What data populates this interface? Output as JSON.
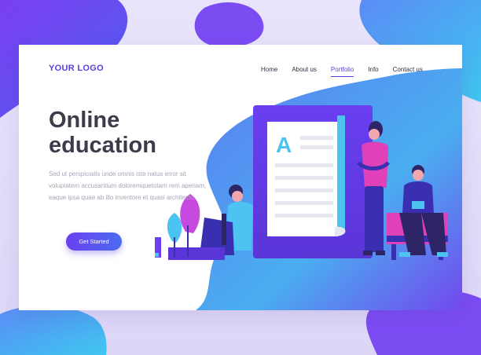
{
  "brand": {
    "logo_text": "YOUR LOGO"
  },
  "nav": {
    "items": [
      "Home",
      "About us",
      "Portfolio",
      "Info",
      "Contact us"
    ],
    "active": "Portfolio"
  },
  "hero": {
    "title_line1": "Online",
    "title_line2": "education",
    "body": "Sed ut perspiciatis unde omnis iste natus error sit voluptatem accusantium doloremquetotam rem aperiam, eaque ipsa quae ab illo inventore et quasi architecto.",
    "cta_label": "Get Started"
  },
  "illustration": {
    "book_letter": "A"
  },
  "colors": {
    "accent": "#5a3fd8",
    "blue": "#4cc3f0",
    "purple": "#6a3ff0",
    "text_dark": "#3c3c4a",
    "text_muted": "#a8a6b6"
  }
}
